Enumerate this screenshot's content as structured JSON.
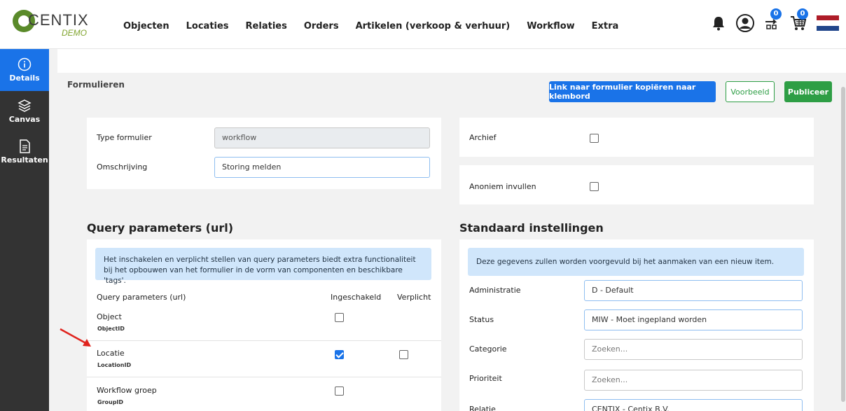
{
  "brand": {
    "name": "CENTIX",
    "sub": "DEMO"
  },
  "nav": [
    "Objecten",
    "Locaties",
    "Relaties",
    "Orders",
    "Artikelen (verkoop & verhuur)",
    "Workflow",
    "Extra"
  ],
  "badges": {
    "transfer": "0",
    "cart": "0"
  },
  "sidebar": [
    {
      "label": "Details",
      "icon": "info-icon",
      "active": true
    },
    {
      "label": "Canvas",
      "icon": "layers-icon",
      "active": false
    },
    {
      "label": "Resultaten",
      "icon": "document-icon",
      "active": false
    }
  ],
  "page": {
    "title": "Formulieren"
  },
  "buttons": {
    "copy_link": "Link naar formulier kopiëren naar klembord",
    "preview": "Voorbeeld",
    "publish": "Publiceer"
  },
  "form": {
    "type_label": "Type formulier",
    "type_value": "workflow",
    "desc_label": "Omschrijving",
    "desc_value": "Storing melden",
    "archive_label": "Archief",
    "archive_checked": false,
    "anon_label": "Anoniem invullen",
    "anon_checked": false
  },
  "query": {
    "heading": "Query parameters (url)",
    "info": "Het inschakelen en verplicht stellen van query parameters biedt extra functionaliteit bij het opbouwen van het formulier in de vorm van componenten en beschikbare 'tags'.",
    "col_name": "Query parameters (url)",
    "col_enabled": "Ingeschakeld",
    "col_required": "Verplicht",
    "rows": [
      {
        "label": "Object",
        "param": "ObjectID",
        "enabled": false,
        "required": null
      },
      {
        "label": "Locatie",
        "param": "LocationID",
        "enabled": true,
        "required": false
      },
      {
        "label": "Workflow groep",
        "param": "GroupID",
        "enabled": false,
        "required": null
      }
    ]
  },
  "defaults": {
    "heading": "Standaard instellingen",
    "info": "Deze gegevens zullen worden voorgevuld bij het aanmaken van een nieuw item.",
    "fields": [
      {
        "label": "Administratie",
        "value": "D - Default",
        "placeholder": ""
      },
      {
        "label": "Status",
        "value": "MIW - Moet ingepland worden",
        "placeholder": ""
      },
      {
        "label": "Categorie",
        "value": "",
        "placeholder": "Zoeken..."
      },
      {
        "label": "Prioriteit",
        "value": "",
        "placeholder": "Zoeken..."
      },
      {
        "label": "Relatie",
        "value": "CENTIX - Centix B.V.",
        "placeholder": ""
      }
    ]
  },
  "colors": {
    "primary": "#1a73e8",
    "success": "#2e9e45",
    "sidebar": "#333333"
  }
}
